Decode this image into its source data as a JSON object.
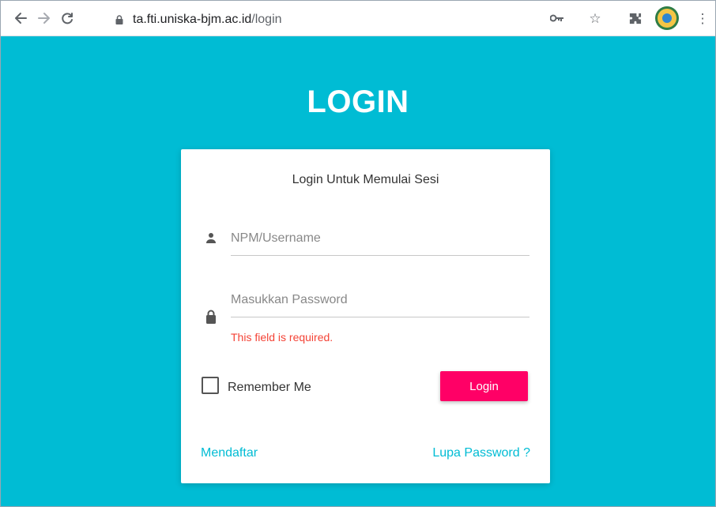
{
  "browser": {
    "url_host": "ta.fti.uniska-bjm.ac.id",
    "url_path": "/login",
    "icons": [
      "back-icon",
      "forward-icon",
      "reload-icon",
      "lock-icon",
      "key-icon",
      "star-icon",
      "extension-icon",
      "profile-icon",
      "menu-icon"
    ]
  },
  "page": {
    "title": "LOGIN",
    "card": {
      "header": "Login Untuk Memulai Sesi",
      "username_placeholder": "NPM/Username",
      "password_placeholder": "Masukkan Password",
      "password_error": "This field is required.",
      "remember_label": "Remember Me",
      "login_label": "Login",
      "signup_link": "Mendaftar",
      "forgot_link": "Lupa Password ?"
    }
  },
  "colors": {
    "background": "#00bcd4",
    "card": "#ffffff",
    "primary_button": "#ff0066",
    "link": "#00bcd4",
    "error": "#f44336"
  }
}
